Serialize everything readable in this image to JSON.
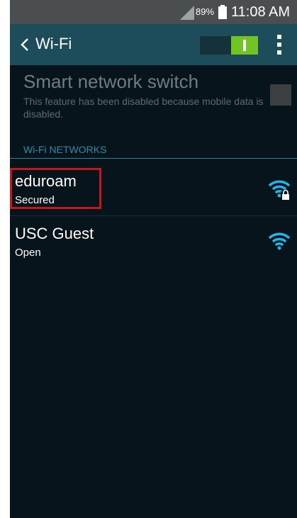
{
  "status_bar": {
    "battery_percent": "89%",
    "time": "11:08 AM",
    "icons": [
      "signal-icon",
      "battery-icon"
    ]
  },
  "header": {
    "title": "Wi-Fi",
    "back_icon": "chevron-left-icon",
    "menu_icon": "overflow-menu-icon",
    "wifi_switch_on": true
  },
  "smart_network_switch": {
    "title": "Smart network switch",
    "description": "This feature has been disabled because mobile data is disabled.",
    "checked": false,
    "enabled": false
  },
  "networks_section": {
    "header": "Wi-Fi NETWORKS",
    "networks": [
      {
        "name": "eduroam",
        "status": "Secured",
        "icon": "wifi-locked-icon",
        "highlighted": true
      },
      {
        "name": "USC Guest",
        "status": "Open",
        "icon": "wifi-icon",
        "highlighted": false
      }
    ]
  },
  "colors": {
    "screen_bg": "#08141b",
    "status_bar_bg": "#4b4e51",
    "action_bar_bg": "#1d4d5b",
    "switch_on": "#72c324",
    "accent": "#2f8aa6",
    "wifi_signal": "#1fb7e8",
    "highlight": "#c6161c"
  }
}
